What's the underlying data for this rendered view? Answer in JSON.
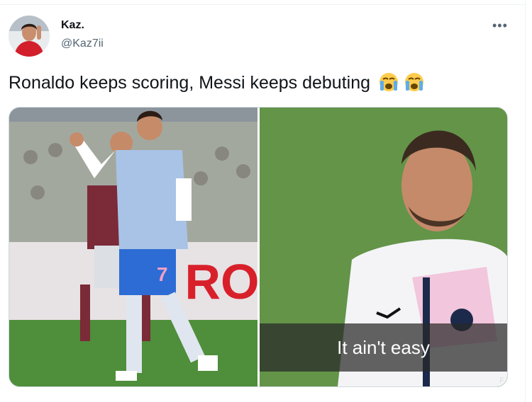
{
  "author": {
    "display_name": "Kaz.",
    "handle": "@Kaz7ii"
  },
  "tweet": {
    "text": "Ronaldo keeps scoring, Messi keeps debuting",
    "emojis": [
      "crying-face-emoji",
      "crying-face-emoji"
    ]
  },
  "media": {
    "left_image": "ronaldo-celebrating-photo",
    "right_image": "messi-reaction-photo",
    "caption": "It ain't easy",
    "watermark": "F"
  },
  "icons": {
    "more": "more-options-icon",
    "avatar": "avatar"
  },
  "colors": {
    "text": "#0f1419",
    "secondary": "#536471",
    "border": "#cfd9de"
  }
}
